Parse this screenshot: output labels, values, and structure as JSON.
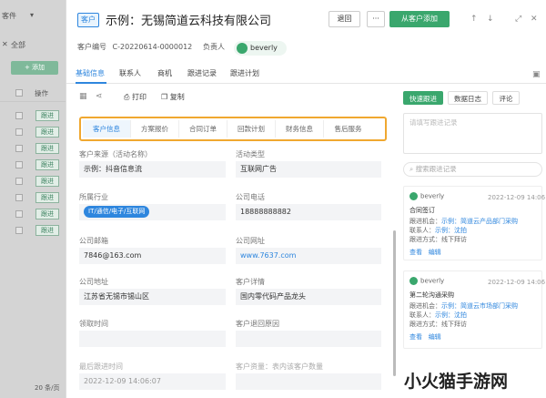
{
  "background": {
    "dropdown_label": "客件",
    "close_label": "全部",
    "add_label": "+ 添加",
    "column_label": "操作",
    "row_tags": [
      "跟进",
      "跟进",
      "跟进",
      "跟进",
      "跟进",
      "跟进",
      "跟进",
      "跟进"
    ],
    "footer_text": "20 条/页"
  },
  "header": {
    "tag": "客户",
    "title": "示例：无锡简道云科技有限公司",
    "back_label": "退回",
    "more_label": "···",
    "add_button": "从客户添加",
    "customer_no_label": "客户编号",
    "customer_no": "C-20220614-0000012",
    "owner_label": "负责人",
    "owner_name": "beverly"
  },
  "tabs": [
    "基础信息",
    "联系人",
    "商机",
    "跟进记录",
    "跟进计划"
  ],
  "toolbar": {
    "print": "打印",
    "copy": "复制"
  },
  "segments": [
    "客户信息",
    "方案报价",
    "合同订单",
    "回款计划",
    "财务信息",
    "售后服务"
  ],
  "fields": {
    "source_label": "客户来源（活动名称）",
    "source_value": "示例：抖音信息流",
    "activity_label": "活动类型",
    "activity_value": "互联网广告",
    "industry_label": "所属行业",
    "industry_value": "IT/通信/电子/互联网",
    "phone_label": "公司电话",
    "phone_value": "18888888882",
    "email_label": "公司邮箱",
    "email_value": "7846@163.com",
    "website_label": "公司网址",
    "website_value": "www.7637.com",
    "address_label": "公司地址",
    "address_value": "江苏省无锡市锡山区",
    "detail_label": "客户详情",
    "detail_value": "国内零代码产品龙头",
    "claim_label": "领取时间",
    "return_label": "客户退回原因",
    "last_follow_label": "最后跟进时间",
    "last_follow_value": "2022-12-09 14:06:07",
    "asset_label": "客户资量：表内该客户数量"
  },
  "right_panel": {
    "tabs": [
      "快速跟进",
      "数据日志",
      "评论"
    ],
    "textarea_placeholder": "请填写跟进记录",
    "search_placeholder": "搜索跟进记录",
    "cards": [
      {
        "user": "beverly",
        "time": "2022-12-09 14:06",
        "title": "合同签订",
        "r1_label": "跟进机会：",
        "r1_value": "示例：简道云产品部门采购",
        "r2_label": "联系人：",
        "r2_value": "示例：沈拍",
        "r3_label": "跟进方式：",
        "r3_value": "线下拜访",
        "view": "查看",
        "edit": "编辑"
      },
      {
        "user": "beverly",
        "time": "2022-12-09 14:06",
        "title": "第二轮沟通采购",
        "r1_label": "跟进机会：",
        "r1_value": "示例：简道云市场部门采购",
        "r2_label": "联系人：",
        "r2_value": "示例：沈拍",
        "r3_label": "跟进方式：",
        "r3_value": "线下拜访",
        "view": "查看",
        "edit": "编辑"
      }
    ]
  },
  "watermark": "小火猫手游网"
}
